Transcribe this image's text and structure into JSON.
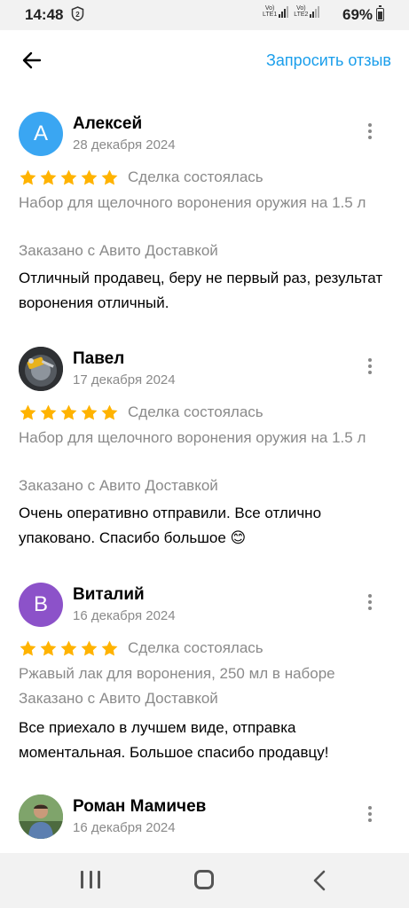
{
  "status": {
    "time": "14:48",
    "sim1": "LTE1",
    "sim2": "LTE2",
    "battery": "69%",
    "battery_level": 0.69
  },
  "header": {
    "back_icon": "arrow-left-icon",
    "request_review": "Запросить отзыв"
  },
  "reviews": [
    {
      "author": "Алексей",
      "avatar_letter": "А",
      "avatar_color": "#3aa6f2",
      "date": "28 декабря 2024",
      "stars": 5,
      "deal": "Сделка состоялась",
      "item": "Набор для щелочного воронения оружия на 1.5 л",
      "delivery": "Заказано с Авито Доставкой",
      "text": "Отличный продавец, беру не первый раз, результат воронения отличный."
    },
    {
      "author": "Павел",
      "avatar_letter": "",
      "avatar_color": "#3b3b3b",
      "date": "17 декабря 2024",
      "stars": 5,
      "deal": "Сделка состоялась",
      "item": "Набор для щелочного воронения оружия на 1.5 л",
      "delivery": "Заказано с Авито Доставкой",
      "text": "Очень оперативно отправили. Все отлично упаковано. Спасибо большое 😊"
    },
    {
      "author": "Виталий",
      "avatar_letter": "В",
      "avatar_color": "#8c52c9",
      "date": "16 декабря 2024",
      "stars": 5,
      "deal": "Сделка состоялась",
      "item": "Ржавый лак для воронения, 250 мл в наборе",
      "delivery": "Заказано с Авито Доставкой",
      "text": "Все приехало в лучшем виде, отправка моментальная. Большое спасибо продавцу!"
    },
    {
      "author": "Роман Мамичев",
      "avatar_letter": "",
      "avatar_color": "#6a8f5a",
      "date": "16 декабря 2024"
    }
  ],
  "colors": {
    "accent": "#1a9eeb",
    "star": "#ffb300",
    "muted": "#8a8a8a"
  },
  "nav": {
    "recent_icon": "recent-apps-icon",
    "home_icon": "home-icon",
    "back_icon": "back-chevron-icon"
  }
}
